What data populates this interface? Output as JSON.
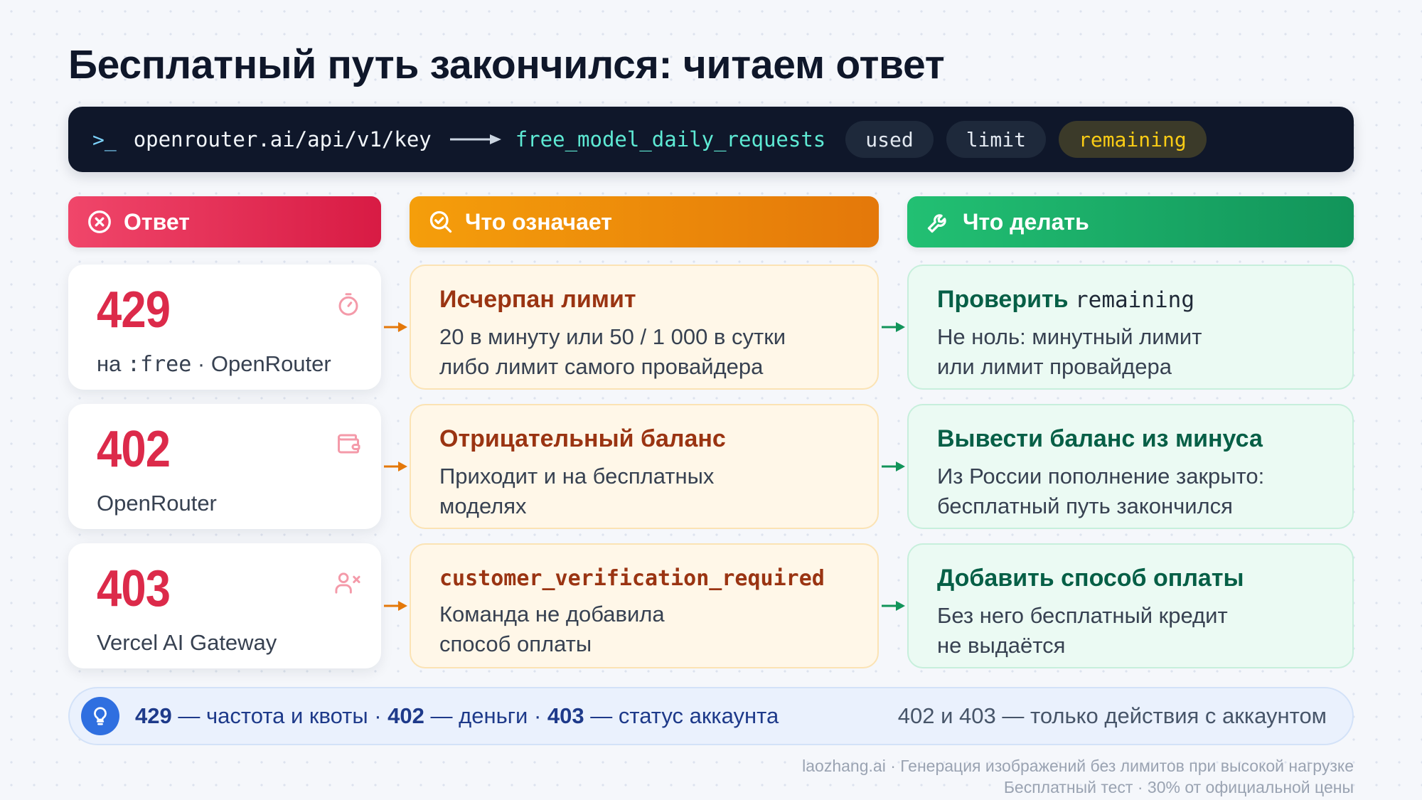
{
  "title": "Бесплатный путь закончился: читаем ответ",
  "terminal": {
    "prompt": ">_",
    "endpoint": "openrouter.ai/api/v1/key",
    "field": "free_model_daily_requests",
    "chips": [
      "used",
      "limit",
      "remaining"
    ],
    "highlighted_chip": "remaining",
    "icons": [
      "terminal-icon",
      "arrow-right-icon"
    ]
  },
  "headers": {
    "response": "Ответ",
    "meaning": "Что означает",
    "action": "Что делать"
  },
  "rows": [
    {
      "code": "429",
      "sub_prefix": "на ",
      "sub_mono": ":free",
      "sub_suffix": " · OpenRouter",
      "icon": "timer-icon",
      "meaning_title": "Исчерпан лимит",
      "meaning_line1": "20 в минуту или 50 / 1 000 в сутки",
      "meaning_line2": "либо лимит самого провайдера",
      "action_title": "Проверить ",
      "action_title_mono": "remaining",
      "action_line1": "Не ноль: минутный лимит",
      "action_line2": "или лимит провайдера"
    },
    {
      "code": "402",
      "sub": "OpenRouter",
      "icon": "wallet-icon",
      "meaning_title": "Отрицательный баланс",
      "meaning_line1": "Приходит и на бесплатных",
      "meaning_line2": "моделях",
      "action_title": "Вывести баланс из минуса",
      "action_line1": "Из России пополнение закрыто:",
      "action_line2": "бесплатный путь закончился"
    },
    {
      "code": "403",
      "sub": "Vercel AI Gateway",
      "icon": "user-x-icon",
      "meaning_title": "customer_verification_required",
      "meaning_line1": "Команда не добавила",
      "meaning_line2": "способ оплаты",
      "action_title": "Добавить способ оплаты",
      "action_line1": "Без него бесплатный кредит",
      "action_line2": "не выдаётся"
    }
  ],
  "summary": {
    "c1": "429",
    "t1": " — частота и квоты · ",
    "c2": "402",
    "t2": " — деньги · ",
    "c3": "403",
    "t3": " — статус аккаунта",
    "right": "402 и 403 — только действия с аккаунтом"
  },
  "footer": {
    "line1": "laozhang.ai · Генерация изображений без лимитов при высокой нагрузке",
    "line2": "Бесплатный тест · 30% от официальной цены"
  },
  "colors": {
    "code": "#dc2a4a",
    "response_header": "#e11d48",
    "meaning_header": "#f59e0b",
    "action_header": "#16a34a",
    "terminal_bg": "#0f172a",
    "summary_accent": "#2f6fe0"
  }
}
